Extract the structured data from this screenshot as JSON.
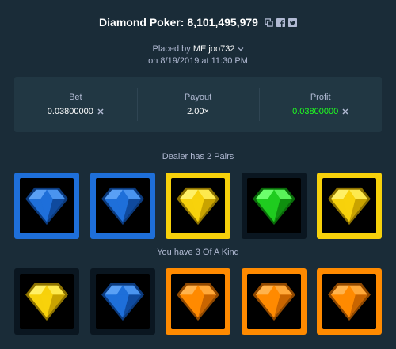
{
  "header": {
    "title": "Diamond Poker:",
    "bet_id": "8,101,495,979",
    "icons": [
      "copy-icon",
      "facebook-icon",
      "twitter-icon"
    ]
  },
  "placed": {
    "prefix": "Placed by",
    "username": "ME joo732",
    "date_line": "on 8/19/2019 at 11:30 PM"
  },
  "stats": {
    "bet_label": "Bet",
    "bet_value": "0.03800000",
    "payout_label": "Payout",
    "payout_value": "2.00×",
    "profit_label": "Profit",
    "profit_value": "0.03800000"
  },
  "dealer": {
    "label": "Dealer has 2 Pairs",
    "cards": [
      {
        "gem": "blue",
        "highlight": "blue"
      },
      {
        "gem": "blue",
        "highlight": "blue"
      },
      {
        "gem": "yellow",
        "highlight": "yellow"
      },
      {
        "gem": "green",
        "highlight": "none"
      },
      {
        "gem": "yellow",
        "highlight": "yellow"
      }
    ]
  },
  "player": {
    "label": "You have 3 Of A Kind",
    "cards": [
      {
        "gem": "yellow",
        "highlight": "none"
      },
      {
        "gem": "blue",
        "highlight": "none"
      },
      {
        "gem": "orange",
        "highlight": "orange"
      },
      {
        "gem": "orange",
        "highlight": "orange"
      },
      {
        "gem": "orange",
        "highlight": "orange"
      }
    ]
  },
  "colors": {
    "background": "#1a2c38",
    "panel": "#213743",
    "profit_green": "#1fff20",
    "gem_blue": "#1e6fd9",
    "gem_yellow": "#f7d10b",
    "gem_green": "#1fcc1f",
    "gem_orange": "#ff8a00"
  }
}
